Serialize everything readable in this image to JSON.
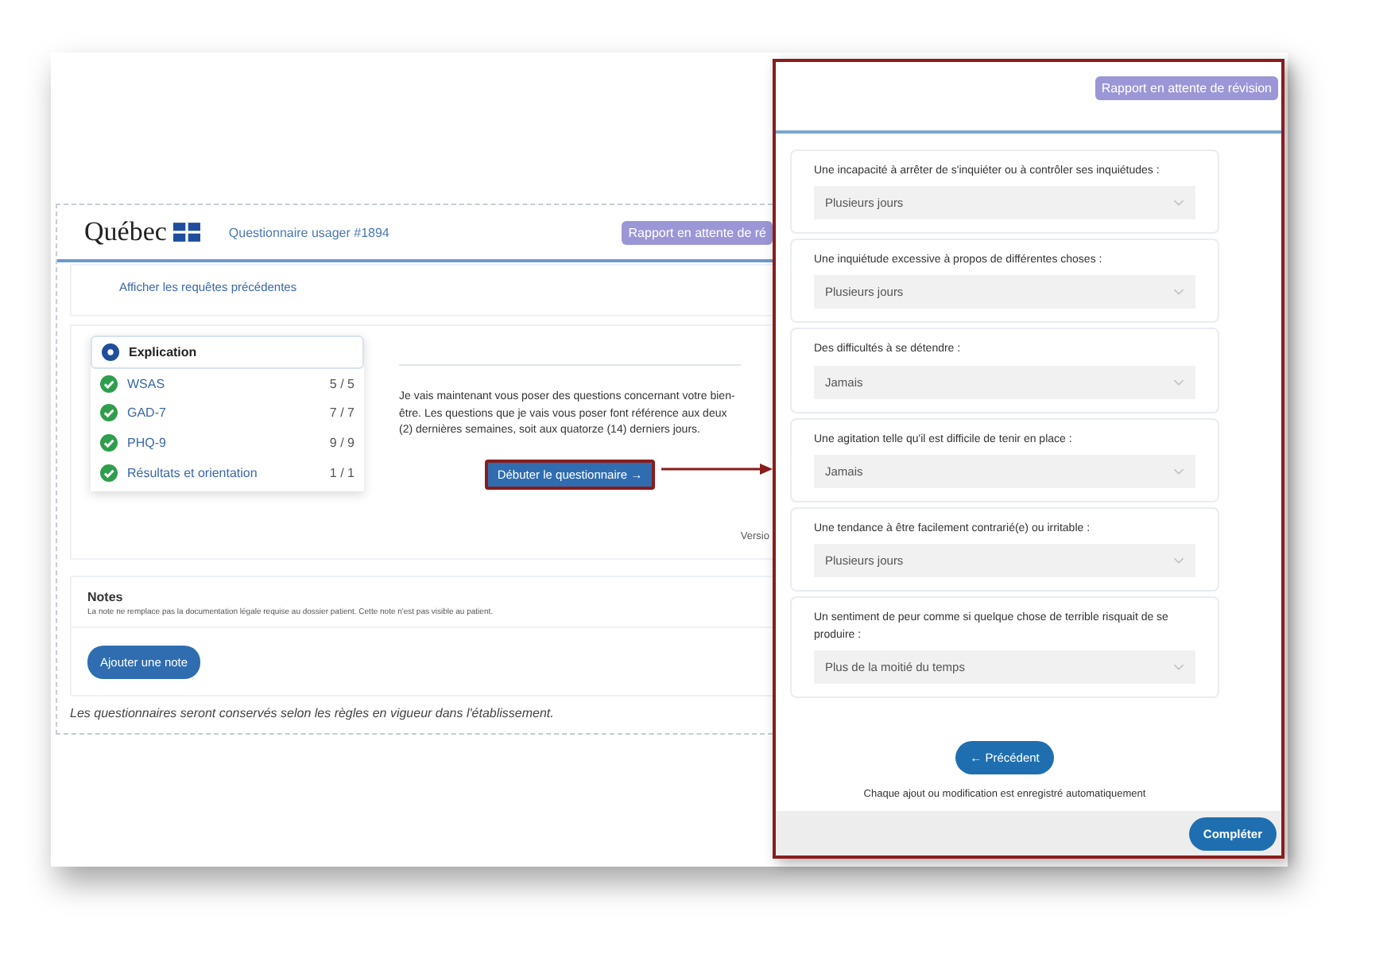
{
  "main_window": {
    "logo": "Québec",
    "title": "Questionnaire usager #1894",
    "status_badge": "Rapport en attente de ré",
    "previous_link": "Afficher les requêtes précédentes",
    "steps": [
      {
        "label": "Explication",
        "selected": true,
        "completed": false
      },
      {
        "label": "WSAS",
        "count": "5 / 5",
        "selected": false,
        "completed": true
      },
      {
        "label": "GAD-7",
        "count": "7 / 7",
        "selected": false,
        "completed": true
      },
      {
        "label": "PHQ-9",
        "count": "9 / 9",
        "selected": false,
        "completed": true
      },
      {
        "label": "Résultats et orientation",
        "count": "1 / 1",
        "selected": false,
        "completed": true
      }
    ],
    "intro": "Je vais maintenant vous poser des questions concernant votre bien-être. Les questions que je vais vous poser font référence aux deux (2) dernières semaines, soit aux quatorze (14) derniers jours.",
    "start_button": "Débuter le questionnaire →",
    "version": "Versio",
    "notes": {
      "title": "Notes",
      "hint": "La note ne remplace pas la documentation légale requise au dossier patient. Cette note n'est pas visible au patient.",
      "add_button": "Ajouter une note"
    },
    "footer": "Les questionnaires seront conservés selon les règles en vigueur dans l'établissement."
  },
  "questionnaire_window": {
    "status_badge": "Rapport en attente de révision",
    "questions": [
      {
        "label": "Une incapacité à arrêter de s'inquiéter ou à contrôler ses inquiétudes :",
        "value": "Plusieurs jours"
      },
      {
        "label": "Une inquiétude excessive à propos de différentes choses :",
        "value": "Plusieurs jours"
      },
      {
        "label": "Des difficultés à se détendre :",
        "value": "Jamais"
      },
      {
        "label": "Une agitation telle qu'il est difficile de tenir en place :",
        "value": "Jamais"
      },
      {
        "label": "Une tendance à être facilement contrarié(e) ou irritable :",
        "value": "Plusieurs jours"
      },
      {
        "label": "Un sentiment de peur comme si quelque chose de terrible risquait de se produire :",
        "value": "Plus de la moitié du temps"
      }
    ],
    "back_button": "← Précédent",
    "autosave_note": "Chaque ajout ou modification est enregistré automatiquement",
    "complete_button": "Compléter"
  }
}
